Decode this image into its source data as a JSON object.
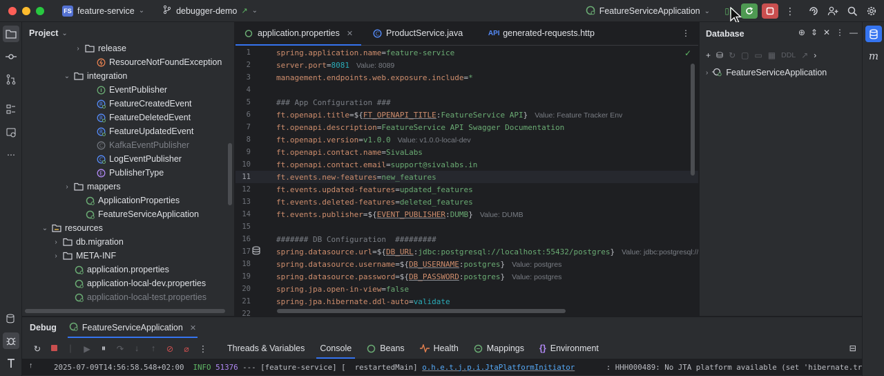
{
  "titlebar": {
    "project_initials": "FS",
    "project_name": "feature-service",
    "branch": "debugger-demo",
    "run_config": "FeatureServiceApplication"
  },
  "project_panel": {
    "title": "Project",
    "items": [
      {
        "label": "release",
        "arrow": "›",
        "icon": "folder-icon",
        "dim": false
      },
      {
        "label": "ResourceNotFoundException",
        "arrow": "",
        "icon": "exception-class-icon",
        "dim": false
      },
      {
        "label": "integration",
        "arrow": "⌄",
        "icon": "folder-icon",
        "dim": false
      },
      {
        "label": "EventPublisher",
        "arrow": "",
        "icon": "interface-icon",
        "dim": false
      },
      {
        "label": "FeatureCreatedEvent",
        "arrow": "",
        "icon": "record-icon",
        "dim": false
      },
      {
        "label": "FeatureDeletedEvent",
        "arrow": "",
        "icon": "record-icon",
        "dim": false
      },
      {
        "label": "FeatureUpdatedEvent",
        "arrow": "",
        "icon": "record-icon",
        "dim": false
      },
      {
        "label": "KafkaEventPublisher",
        "arrow": "",
        "icon": "class-icon",
        "dim": true
      },
      {
        "label": "LogEventPublisher",
        "arrow": "",
        "icon": "spring-bean-icon",
        "dim": false
      },
      {
        "label": "PublisherType",
        "arrow": "",
        "icon": "enum-icon",
        "dim": false
      },
      {
        "label": "mappers",
        "arrow": "›",
        "icon": "folder-icon",
        "dim": false
      },
      {
        "label": "ApplicationProperties",
        "arrow": "",
        "icon": "spring-config-icon",
        "dim": false
      },
      {
        "label": "FeatureServiceApplication",
        "arrow": "",
        "icon": "spring-boot-icon",
        "dim": false
      },
      {
        "label": "resources",
        "arrow": "⌄",
        "icon": "resources-folder-icon",
        "dim": false
      },
      {
        "label": "db.migration",
        "arrow": "›",
        "icon": "folder-icon",
        "dim": false
      },
      {
        "label": "META-INF",
        "arrow": "›",
        "icon": "folder-icon",
        "dim": false
      },
      {
        "label": "application.properties",
        "arrow": "",
        "icon": "spring-properties-icon",
        "dim": false
      },
      {
        "label": "application-local-dev.properties",
        "arrow": "",
        "icon": "spring-properties-icon",
        "dim": false
      },
      {
        "label": "application-local-test.properties",
        "arrow": "",
        "icon": "spring-properties-icon",
        "dim": true
      }
    ]
  },
  "editor": {
    "tabs": [
      {
        "label": "application.properties",
        "active": true
      },
      {
        "label": "ProductService.java",
        "active": false
      },
      {
        "label": "generated-requests.http",
        "active": false
      }
    ],
    "current_line": "11",
    "lines": [
      {
        "no": "1",
        "parts": [
          [
            "k",
            "spring.application.name"
          ],
          [
            "t",
            "="
          ],
          [
            "v",
            "feature-service"
          ]
        ]
      },
      {
        "no": "2",
        "parts": [
          [
            "k",
            "server.port"
          ],
          [
            "t",
            "="
          ],
          [
            "n",
            "8081"
          ],
          [
            "h",
            "Value: 8089"
          ]
        ]
      },
      {
        "no": "3",
        "parts": [
          [
            "k",
            "management.endpoints.web.exposure.include"
          ],
          [
            "t",
            "="
          ],
          [
            "v",
            "*"
          ]
        ]
      },
      {
        "no": "4",
        "parts": []
      },
      {
        "no": "5",
        "parts": [
          [
            "c",
            "### App Configuration ###"
          ]
        ]
      },
      {
        "no": "6",
        "parts": [
          [
            "k",
            "ft.openapi.title"
          ],
          [
            "t",
            "=${"
          ],
          [
            "ku",
            "FT_OPENAPI_TITLE"
          ],
          [
            "t",
            ":"
          ],
          [
            "v",
            "FeatureService API"
          ],
          [
            "t",
            "}"
          ],
          [
            "h",
            "Value: Feature Tracker Env"
          ]
        ]
      },
      {
        "no": "7",
        "parts": [
          [
            "k",
            "ft.openapi.description"
          ],
          [
            "t",
            "="
          ],
          [
            "v",
            "FeatureService API Swagger Documentation"
          ]
        ]
      },
      {
        "no": "8",
        "parts": [
          [
            "k",
            "ft.openapi.version"
          ],
          [
            "t",
            "="
          ],
          [
            "v",
            "v1.0.0"
          ],
          [
            "h",
            "Value: v1.0.0-local-dev"
          ]
        ]
      },
      {
        "no": "9",
        "parts": [
          [
            "k",
            "ft.openapi.contact.name"
          ],
          [
            "t",
            "="
          ],
          [
            "v",
            "SivaLabs"
          ]
        ]
      },
      {
        "no": "10",
        "parts": [
          [
            "k",
            "ft.openapi.contact.email"
          ],
          [
            "t",
            "="
          ],
          [
            "v",
            "support@sivalabs.in"
          ]
        ]
      },
      {
        "no": "11",
        "parts": [
          [
            "k",
            "ft.events.new-features"
          ],
          [
            "t",
            "="
          ],
          [
            "v",
            "new_features"
          ]
        ]
      },
      {
        "no": "12",
        "parts": [
          [
            "k",
            "ft.events.updated-features"
          ],
          [
            "t",
            "="
          ],
          [
            "v",
            "updated_features"
          ]
        ]
      },
      {
        "no": "13",
        "parts": [
          [
            "k",
            "ft.events.deleted-features"
          ],
          [
            "t",
            "="
          ],
          [
            "v",
            "deleted_features"
          ]
        ]
      },
      {
        "no": "14",
        "parts": [
          [
            "k",
            "ft.events.publisher"
          ],
          [
            "t",
            "=${"
          ],
          [
            "ku",
            "EVENT_PUBLISHER"
          ],
          [
            "t",
            ":"
          ],
          [
            "v",
            "DUMB"
          ],
          [
            "t",
            "}"
          ],
          [
            "h",
            "Value: DUMB"
          ]
        ]
      },
      {
        "no": "15",
        "parts": []
      },
      {
        "no": "16",
        "parts": [
          [
            "c",
            "####### DB Configuration  #########"
          ]
        ]
      },
      {
        "no": "17",
        "parts": [
          [
            "k",
            "spring.datasource.url"
          ],
          [
            "t",
            "=${"
          ],
          [
            "ku",
            "DB_URL"
          ],
          [
            "t",
            ":"
          ],
          [
            "v",
            "jdbc:postgresql://localhost:55432/postgres"
          ],
          [
            "t",
            "}"
          ],
          [
            "h",
            "Value: jdbc:postgresql://"
          ]
        ]
      },
      {
        "no": "18",
        "parts": [
          [
            "k",
            "spring.datasource.username"
          ],
          [
            "t",
            "=${"
          ],
          [
            "ku",
            "DB_USERNAME"
          ],
          [
            "t",
            ":"
          ],
          [
            "v",
            "postgres"
          ],
          [
            "t",
            "}"
          ],
          [
            "h",
            "Value: postgres"
          ]
        ]
      },
      {
        "no": "19",
        "parts": [
          [
            "k",
            "spring.datasource.password"
          ],
          [
            "t",
            "=${"
          ],
          [
            "ku",
            "DB_PASSWORD"
          ],
          [
            "t",
            ":"
          ],
          [
            "v",
            "postgres"
          ],
          [
            "t",
            "}"
          ],
          [
            "h",
            "Value: postgres"
          ]
        ]
      },
      {
        "no": "20",
        "parts": [
          [
            "k",
            "spring.jpa.open-in-view"
          ],
          [
            "t",
            "="
          ],
          [
            "v",
            "false"
          ]
        ]
      },
      {
        "no": "21",
        "parts": [
          [
            "k",
            "spring.jpa.hibernate.ddl-auto"
          ],
          [
            "t",
            "="
          ],
          [
            "n",
            "validate"
          ]
        ]
      },
      {
        "no": "22",
        "parts": []
      }
    ]
  },
  "database": {
    "title": "Database",
    "ddl_label": "DDL",
    "tree_item": "FeatureServiceApplication"
  },
  "debug": {
    "title": "Debug",
    "session_tab": "FeatureServiceApplication",
    "views": [
      {
        "label": "Threads & Variables",
        "icon": ""
      },
      {
        "label": "Console",
        "icon": "",
        "active": true
      },
      {
        "label": "Beans",
        "icon": "beans-icon"
      },
      {
        "label": "Health",
        "icon": "health-icon"
      },
      {
        "label": "Mappings",
        "icon": "mappings-icon"
      },
      {
        "label": "Environment",
        "icon": "environment-icon"
      }
    ],
    "console": {
      "timestamp": "2025-07-09T14:56:58.548+02:00",
      "level": "INFO",
      "pid": "51376",
      "sep": "---",
      "app": "[feature-service]",
      "thread": "[  restartedMain]",
      "logger": "o.h.e.t.j.p.i.JtaPlatformInitiator",
      "message": ": HHH000489: No JTA platform available (set 'hibernate.tra"
    }
  },
  "colors": {
    "accent": "#3574f0",
    "keyword": "#cf8e6d",
    "string_value": "#6aab73",
    "number": "#2aacb8",
    "debug_green": "#4e9a52",
    "stop_red": "#c94f4f"
  }
}
